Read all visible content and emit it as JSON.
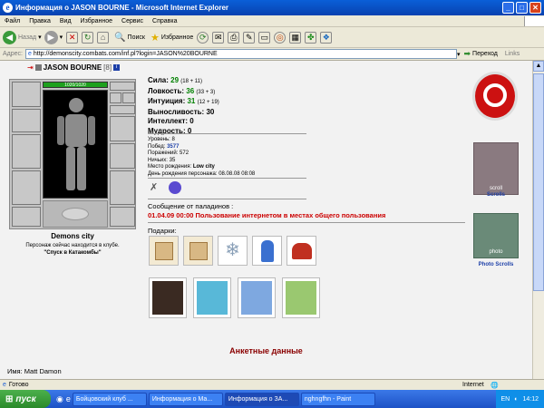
{
  "window": {
    "title": "Информация о JASON BOURNE - Microsoft Internet Explorer"
  },
  "menu": [
    "Файл",
    "Правка",
    "Вид",
    "Избранное",
    "Сервис",
    "Справка"
  ],
  "toolbar": {
    "back": "Назад",
    "search": "Поиск",
    "favorites": "Избранное"
  },
  "address": {
    "label": "Адрес:",
    "url": "http://demonscity.combats.com/inf.pl?login=JASON%20BOURNE",
    "go": "Переход",
    "links": "Links"
  },
  "character": {
    "name": "JASON BOURNE",
    "level": "[8]",
    "hp": "1020/1020",
    "hp_fraction": 1.0,
    "city_caption": "Demons city",
    "location_text": "Персонаж сейчас находится в клубе.",
    "location_name": "\"Спуск в Катакомбы\""
  },
  "stats": [
    {
      "label": "Сила:",
      "value": "29",
      "detail": "(18 + 11)",
      "green": true
    },
    {
      "label": "Ловкость:",
      "value": "36",
      "detail": "(33 + 3)",
      "green": true
    },
    {
      "label": "Интуиция:",
      "value": "31",
      "detail": "(12 + 19)",
      "green": true
    },
    {
      "label": "Выносливость:",
      "value": "30",
      "detail": "",
      "green": false
    },
    {
      "label": "Интеллект:",
      "value": "0",
      "detail": "",
      "green": false
    },
    {
      "label": "Мудрость:",
      "value": "0",
      "detail": "",
      "green": false
    }
  ],
  "info": {
    "level": "Уровень: 8",
    "wins_label": "Побед:",
    "wins": "3577",
    "losses": "Поражений: 572",
    "draws": "Ничьих: 35",
    "birthplace_label": "Место рождения:",
    "birthplace": "Low city",
    "birthday": "День рождения персонажа: 08.08.08 08:08"
  },
  "paladin": {
    "header": "Сообщение от паладинов :",
    "message": "01.04.09 00:00 Пользование интернетом в местах общего пользования"
  },
  "gifts_label": "Подарки:",
  "side": {
    "scrolls": "Scrolls",
    "photo_scrolls": "Photo Scrolls",
    "scroll_sub": "scroll",
    "photo_sub": "photo"
  },
  "profile": {
    "header": "Анкетные данные",
    "name": "Имя: Matt Damon"
  },
  "status": {
    "text": "Готово",
    "zone": "Internet"
  },
  "taskbar": {
    "start": "пуск",
    "tasks": [
      "Бойцовский клуб ...",
      "Информация о Ма...",
      "Информация о ЗА...",
      "nghngfhn - Paint"
    ],
    "lang": "EN",
    "clock": "14:12"
  },
  "colors": {
    "accent_red": "#cc0000",
    "win_green": "#008000",
    "title_blue": "#0a5fd8"
  }
}
